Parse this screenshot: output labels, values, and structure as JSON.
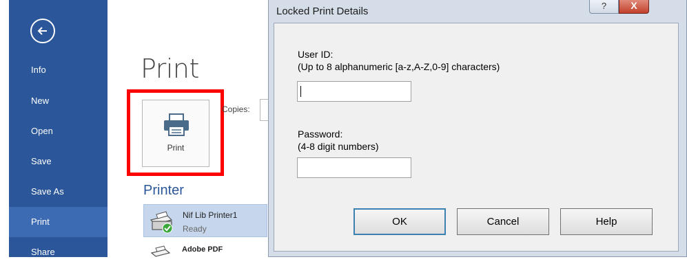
{
  "sidebar": {
    "items": [
      {
        "label": "Info"
      },
      {
        "label": "New"
      },
      {
        "label": "Open"
      },
      {
        "label": "Save"
      },
      {
        "label": "Save As"
      },
      {
        "label": "Print",
        "active": true
      },
      {
        "label": "Share"
      }
    ]
  },
  "print_pane": {
    "title": "Print",
    "print_button_label": "Print",
    "copies_label": "Copies:",
    "printer_section_title": "Printer",
    "printers": [
      {
        "name": "Nif Lib Printer1",
        "status": "Ready",
        "selected": true
      },
      {
        "name": "Adobe PDF",
        "status": ""
      }
    ]
  },
  "dialog": {
    "title": "Locked Print Details",
    "help_glyph": "?",
    "close_glyph": "X",
    "user_id_label": "User ID:",
    "user_id_hint": "(Up to 8 alphanumeric [a-z,A-Z,0-9] characters)",
    "user_id_value": "",
    "password_label": "Password:",
    "password_hint": "(4-8 digit numbers)",
    "password_value": "",
    "buttons": {
      "ok": "OK",
      "cancel": "Cancel",
      "help": "Help"
    }
  },
  "colors": {
    "sidebar_bg": "#2b579a",
    "sidebar_active": "#3c6bb3",
    "highlight": "#ff0000",
    "accent_text": "#2b579a",
    "dialog_frame": "#d5dde8"
  }
}
